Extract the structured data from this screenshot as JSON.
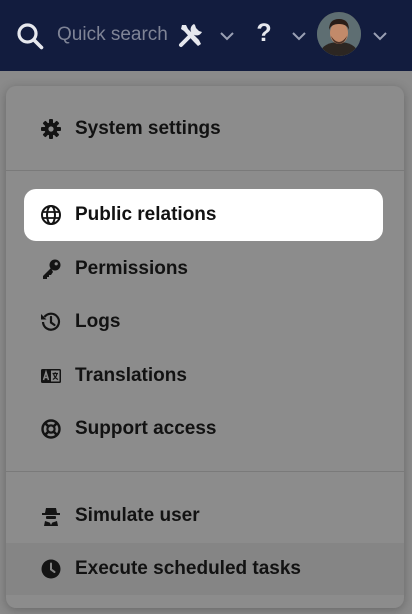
{
  "topbar": {
    "search_placeholder": "Quick search",
    "help_label": "?"
  },
  "menu": {
    "sections": [
      {
        "items": [
          {
            "label": "System settings",
            "icon": "gear-icon"
          }
        ]
      },
      {
        "items": [
          {
            "label": "Public relations",
            "icon": "globe-icon",
            "active": true
          },
          {
            "label": "Permissions",
            "icon": "key-icon"
          },
          {
            "label": "Logs",
            "icon": "history-icon"
          },
          {
            "label": "Translations",
            "icon": "translate-icon"
          },
          {
            "label": "Support access",
            "icon": "lifebuoy-icon"
          }
        ]
      },
      {
        "items": [
          {
            "label": "Simulate user",
            "icon": "spy-icon"
          },
          {
            "label": "Execute scheduled tasks",
            "icon": "clock-icon"
          }
        ]
      }
    ]
  },
  "colors": {
    "topbar": "#121c3e",
    "overlay_menu": "#8c8c8c",
    "active_item": "#ffffff",
    "text": "#121212"
  }
}
